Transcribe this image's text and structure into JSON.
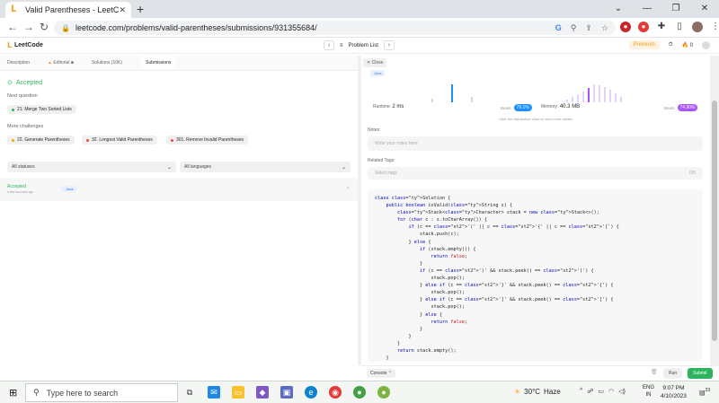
{
  "browser": {
    "tab_title": "Valid Parentheses - LeetCode",
    "url": "leetcode.com/problems/valid-parentheses/submissions/931355684/"
  },
  "header": {
    "logo": "LeetCode",
    "problem_list": "Problem List",
    "premium": "Premium",
    "streak": "0"
  },
  "left_tabs": [
    "Description",
    "Editorial",
    "Solutions (10K)",
    "Submissions"
  ],
  "result": {
    "status": "Accepted",
    "next_question_label": "Next question",
    "next_question": "21. Merge Two Sorted Lists",
    "more_challenges_label": "More challenges",
    "challenges": [
      {
        "label": "22. Generate Parentheses",
        "color": "#f0a500"
      },
      {
        "label": "32. Longest Valid Parentheses",
        "color": "#ef4743"
      },
      {
        "label": "301. Remove Invalid Parentheses",
        "color": "#ef4743"
      }
    ]
  },
  "filters": {
    "status": "All statuses",
    "language": "All languages"
  },
  "submission": {
    "status": "Accepted",
    "time": "a few seconds ago",
    "language": "Java"
  },
  "right": {
    "close": "Close",
    "language": "Java",
    "runtime_label": "Runtime:",
    "runtime_value": "2 ms",
    "runtime_beats_label": "Beats",
    "runtime_beats": "79.1%",
    "memory_label": "Memory:",
    "memory_value": "40.3 MB",
    "memory_beats_label": "Beats",
    "memory_beats": "74.90%",
    "chart_hint": "Click the distribution chart to view more details",
    "notes_label": "Notes:",
    "notes_placeholder": "Write your notes here",
    "tags_label": "Related Tags:",
    "tags_placeholder": "Select tags",
    "tags_count": "0/5"
  },
  "chart_data": [
    {
      "type": "bar",
      "title": "",
      "values": [
        0.2,
        1,
        0.3
      ],
      "highlight": 1,
      "color": "#1a90ff"
    },
    {
      "type": "bar",
      "title": "",
      "values": [
        0.15,
        0.3,
        0.45,
        0.6,
        0.8,
        1,
        0.95,
        0.85,
        0.7,
        0.5,
        0.3
      ],
      "highlight": 4,
      "color": "#a855f7"
    }
  ],
  "code": [
    {
      "t": "class Solution {",
      "k": []
    },
    {
      "t": "    public boolean isValid(String s) {",
      "k": []
    },
    {
      "t": "        Stack<Character> stack = new Stack<>();",
      "k": []
    },
    {
      "t": "        for (char c : s.toCharArray()) {",
      "k": []
    },
    {
      "t": "            if (c == '(' || c == '{' || c == '[') {",
      "k": []
    },
    {
      "t": "                stack.push(c);",
      "k": []
    },
    {
      "t": "            } else {",
      "k": []
    },
    {
      "t": "                if (stack.empty()) {",
      "k": []
    },
    {
      "t": "                    return false;",
      "k": []
    },
    {
      "t": "                }",
      "k": []
    },
    {
      "t": "                if (c == ')' && stack.peek() == '(') {",
      "k": []
    },
    {
      "t": "                    stack.pop();",
      "k": []
    },
    {
      "t": "                } else if (c == '}' && stack.peek() == '{') {",
      "k": []
    },
    {
      "t": "                    stack.pop();",
      "k": []
    },
    {
      "t": "                } else if (c == ']' && stack.peek() == '[') {",
      "k": []
    },
    {
      "t": "                    stack.pop();",
      "k": []
    },
    {
      "t": "                } else {",
      "k": []
    },
    {
      "t": "                    return false;",
      "k": []
    },
    {
      "t": "                }",
      "k": []
    },
    {
      "t": "            }",
      "k": []
    },
    {
      "t": "        }",
      "k": []
    },
    {
      "t": "        return stack.empty();",
      "k": []
    },
    {
      "t": "    }",
      "k": []
    },
    {
      "t": "}",
      "k": []
    }
  ],
  "bottom": {
    "console": "Console",
    "run": "Run",
    "submit": "Submit"
  },
  "taskbar": {
    "search_placeholder": "Type here to search",
    "temperature": "30°C",
    "weather": "Haze",
    "lang": "ENG",
    "region": "IN",
    "time": "9:07 PM",
    "date": "4/10/2023",
    "notifications": "23"
  }
}
